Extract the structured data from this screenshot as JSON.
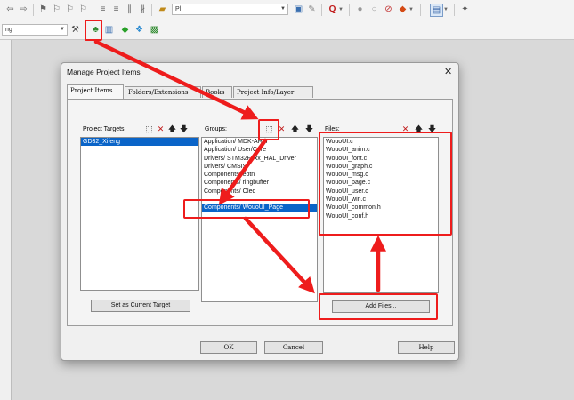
{
  "toolbar": {
    "target_combo_value": "Pl",
    "left_combo_value": "ng"
  },
  "dialog": {
    "title": "Manage Project Items",
    "close_glyph": "✕",
    "tabs": [
      "Project Items",
      "Folders/Extensions",
      "Books",
      "Project Info/Layer"
    ],
    "targets": {
      "title": "Project Targets:",
      "items": [
        {
          "label": "GD32_Xifeng",
          "selected": true
        }
      ],
      "set_target_button": "Set as Current Target"
    },
    "groups": {
      "title": "Groups:",
      "items": [
        {
          "label": "Application/ MDK-ARM",
          "selected": false
        },
        {
          "label": "Application/ User/Core",
          "selected": false
        },
        {
          "label": "Drivers/ STM32F4xx_HAL_Driver",
          "selected": false
        },
        {
          "label": "Drivers/ CMSIS",
          "selected": false
        },
        {
          "label": "Components/ ebtn",
          "selected": false
        },
        {
          "label": "Components/ ringbuffer",
          "selected": false
        },
        {
          "label": "Components/ Oled",
          "selected": false
        },
        {
          "label": "",
          "selected": false
        },
        {
          "label": "Components/ WouoUI_Page",
          "selected": true
        }
      ]
    },
    "files": {
      "title": "Files:",
      "items": [
        "WouoUI.c",
        "WouoUI_anim.c",
        "WouoUI_font.c",
        "WouoUI_graph.c",
        "WouoUI_msg.c",
        "WouoUI_page.c",
        "WouoUI_user.c",
        "WouoUI_win.c",
        "WouoUI_common.h",
        "WouoUI_conf.h"
      ],
      "add_button": "Add Files..."
    },
    "buttons": {
      "ok": "OK",
      "cancel": "Cancel",
      "help": "Help"
    }
  },
  "colors": {
    "annotation_red": "#ee1c1c",
    "selection_blue": "#0a64c8"
  },
  "icons": {
    "pane_new": "new-item-icon",
    "pane_delete": "delete-icon",
    "pane_up": "move-up-icon",
    "pane_down": "move-down-icon"
  }
}
